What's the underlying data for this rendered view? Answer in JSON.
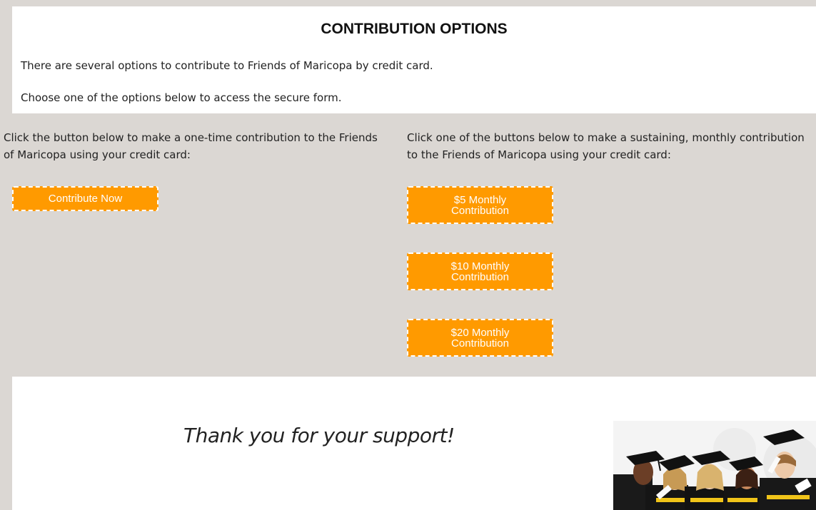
{
  "header": {
    "title": "CONTRIBUTION OPTIONS",
    "intro_line1": "There are several options to contribute to Friends of Maricopa by credit card.",
    "intro_line2": "Choose one of the options below to access the secure form."
  },
  "one_time": {
    "text": "Click the button below to make a one-time contribution to the Friends of Maricopa using your credit card:",
    "button_label": "Contribute Now"
  },
  "monthly": {
    "text": "Click one of the buttons below to make a sustaining, monthly contribution to the Friends of Maricopa using your credit card:",
    "buttons": [
      {
        "label": "$5 Monthly Contribution"
      },
      {
        "label": "$10 Monthly Contribution"
      },
      {
        "label": "$20 Monthly Contribution"
      }
    ]
  },
  "footer": {
    "thanks": "Thank you for your support!",
    "image_subject": "graduates-photo"
  },
  "colors": {
    "button": "#ff9a00",
    "panel_gray": "#dbd7d3",
    "white": "#ffffff"
  }
}
